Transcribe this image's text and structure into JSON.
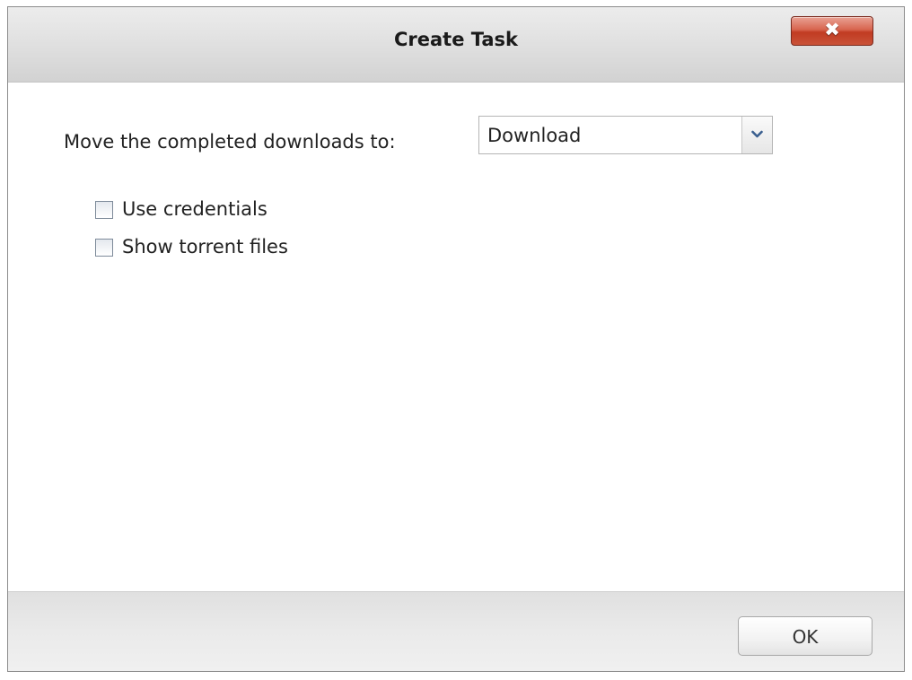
{
  "dialog": {
    "title": "Create Task",
    "close_glyph": "✖",
    "close_icon": "close-icon",
    "close_color": "#c13b22"
  },
  "destination": {
    "label": "Move the completed downloads to:",
    "selected": "Download",
    "arrow_icon": "chevron-down-icon"
  },
  "options": [
    {
      "label": "Use credentials",
      "checked": false
    },
    {
      "label": "Show torrent files",
      "checked": false
    }
  ],
  "footer": {
    "ok_label": "OK"
  }
}
